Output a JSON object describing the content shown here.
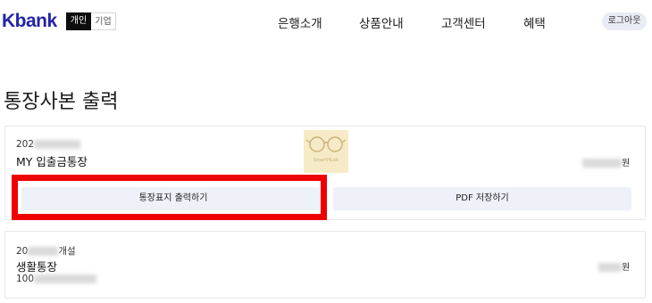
{
  "header": {
    "logo": "Kbank",
    "segments": {
      "personal": "개인",
      "business": "기업"
    },
    "nav": [
      "은행소개",
      "상품안내",
      "고객센터",
      "혜택"
    ],
    "logout": "로그아웃"
  },
  "page": {
    "title": "통장사본 출력"
  },
  "accounts": [
    {
      "number_prefix": "202",
      "name": "MY 입출금통장",
      "balance_suffix": "원",
      "buttons": {
        "print_cover": "통장표지 출력하기",
        "save_pdf": "PDF 저장하기"
      }
    },
    {
      "opened_prefix": "20",
      "opened_suffix": "개설",
      "name": "생활통장",
      "number_prefix": "100",
      "balance_suffix": "원"
    }
  ],
  "watermark": {
    "text": "SmartHLab"
  },
  "colors": {
    "brand": "#2323a8",
    "highlight": "#ee0000",
    "button_bg": "#eef1f8"
  }
}
